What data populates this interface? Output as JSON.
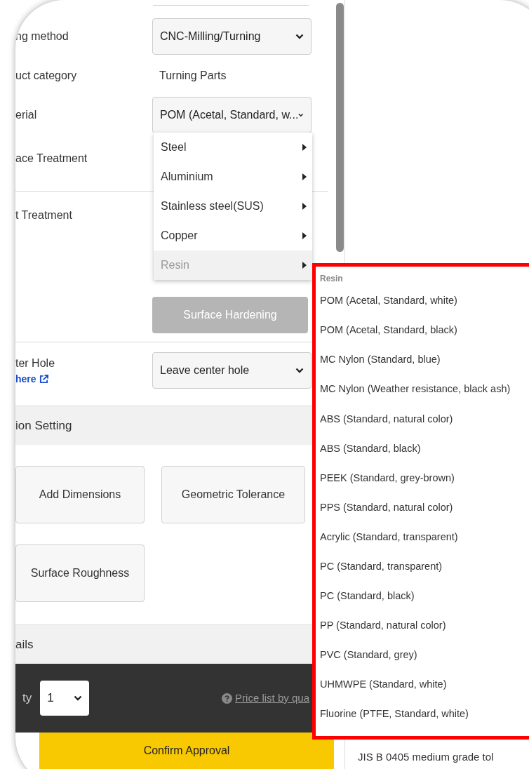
{
  "form_rows": [
    {
      "kind": "select",
      "label": "ng method",
      "value": "CNC-Milling/Turning"
    },
    {
      "kind": "text",
      "label": "uct category",
      "value": "Turning Parts"
    },
    {
      "kind": "select",
      "label": "erial",
      "value": "POM (Acetal, Standard, w..."
    },
    {
      "kind": "label",
      "label": "ace Treatment"
    },
    {
      "kind": "divider"
    },
    {
      "kind": "button",
      "label": "t Treatment",
      "value": "Surface Hardening",
      "disabled": true
    },
    {
      "kind": "divider"
    },
    {
      "kind": "select",
      "label": "ter Hole",
      "link": "here",
      "value": "Leave center hole"
    }
  ],
  "sections": [
    {
      "title": "ion Setting",
      "buttons": [
        "Add Dimensions",
        "Geometric Tolerance",
        "Surface Roughness"
      ]
    },
    {
      "title": "ails"
    }
  ],
  "quantity": {
    "label": "ty",
    "value": "1",
    "price_link": "Price list by qua"
  },
  "confirm_button": "Confirm Approval",
  "side_note": "JIS B 0405 medium grade tol",
  "material_menu": [
    {
      "label": "Steel",
      "selected": false
    },
    {
      "label": "Aluminium",
      "selected": false
    },
    {
      "label": "Stainless steel(SUS)",
      "selected": false
    },
    {
      "label": "Copper",
      "selected": false
    },
    {
      "label": "Resin",
      "selected": true
    }
  ],
  "submenu": {
    "heading": "Resin",
    "items": [
      "POM (Acetal, Standard, white)",
      "POM (Acetal, Standard, black)",
      "MC Nylon (Standard, blue)",
      "MC Nylon (Weather resistance, black ash)",
      "ABS (Standard, natural color)",
      "ABS (Standard, black)",
      "PEEK (Standard, grey-brown)",
      "PPS (Standard, natural color)",
      "Acrylic (Standard, transparent)",
      "PC (Standard, transparent)",
      "PC (Standard, black)",
      "PP (Standard, natural color)",
      "PVC (Standard, grey)",
      "UHMWPE (Standard, white)",
      "Fluorine (PTFE, Standard, white)"
    ]
  }
}
